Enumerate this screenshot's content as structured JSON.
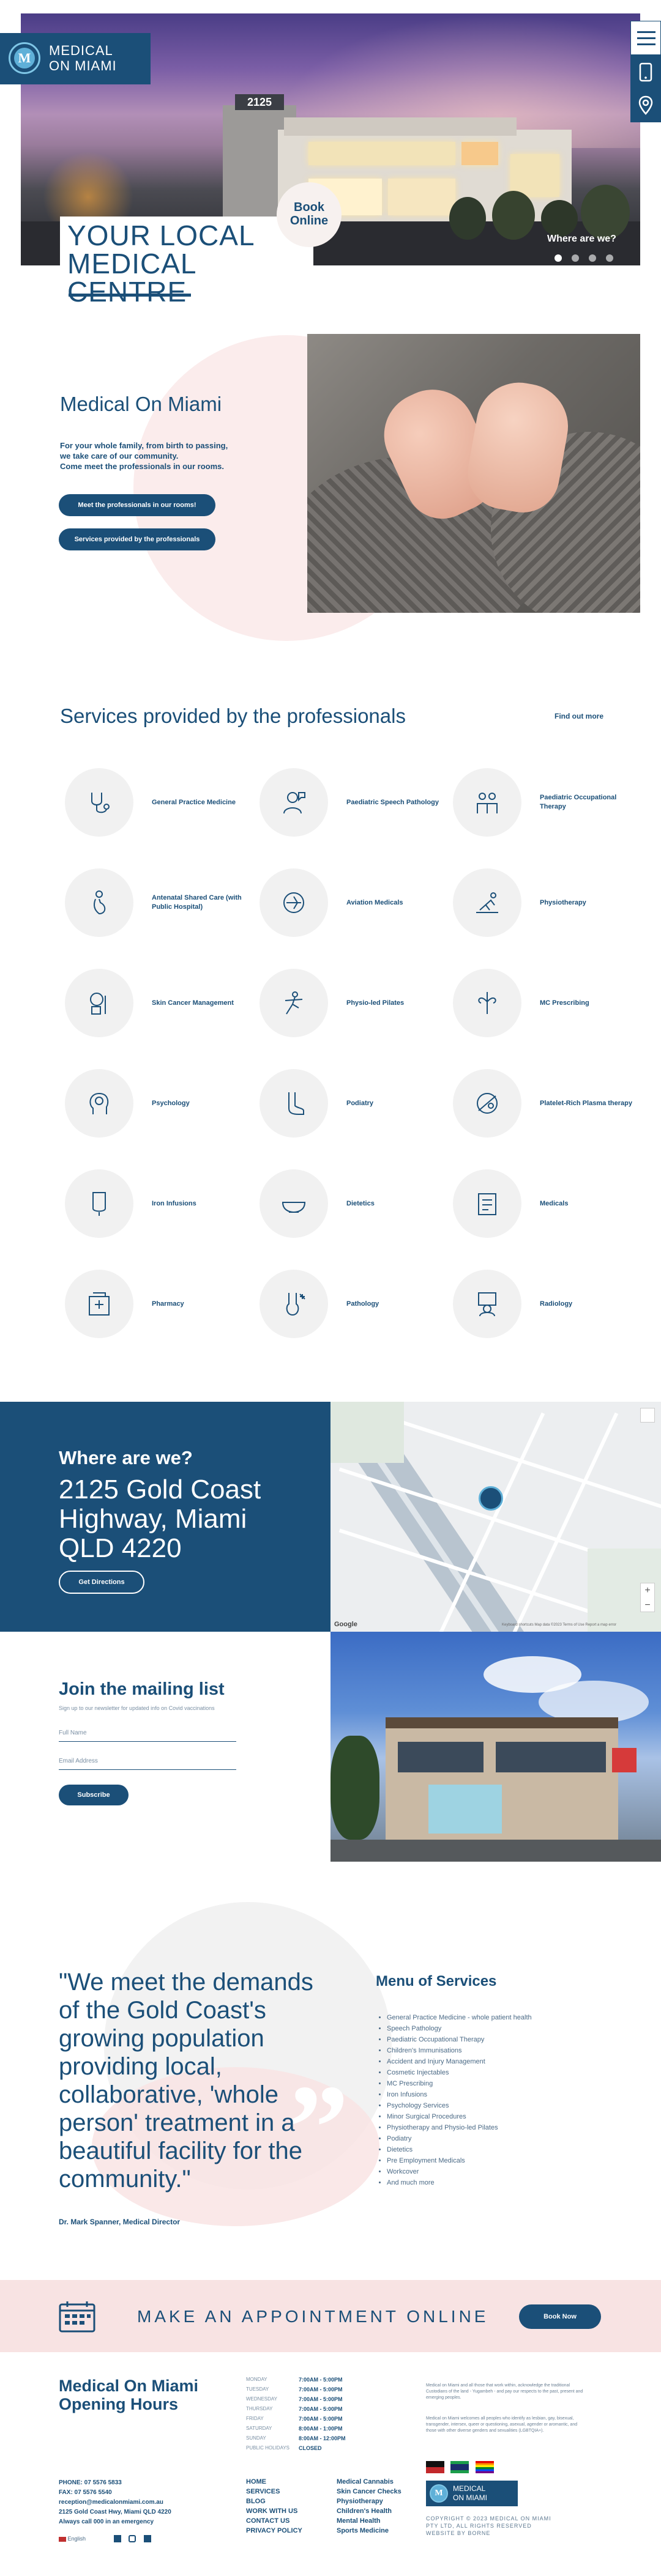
{
  "header": {
    "logo_text": "MEDICAL\nON MIAMI",
    "logo_text_line1": "MEDICAL",
    "logo_text_line2": "ON MIAMI",
    "book_online": "Book\nOnline",
    "book_line1": "Book",
    "book_line2": "Online",
    "hero_title_line1": "YOUR LOCAL",
    "hero_title_line2": "MEDICAL CENTRE",
    "hero_caption": "Where are we?"
  },
  "intro": {
    "title": "Medical On Miami",
    "text_line1": "For your whole family, from birth to passing,",
    "text_line2": "we take care of our community.",
    "text_line3": "Come meet the professionals in our rooms.",
    "btn_professionals": "Meet the professionals in our rooms!",
    "btn_services": "Services provided by the professionals"
  },
  "services": {
    "title": "Services provided by the professionals",
    "find_out_more": "Find out more",
    "items": [
      {
        "label": "General Practice Medicine",
        "icon": "stethoscope-icon"
      },
      {
        "label": "Paediatric Speech Pathology",
        "icon": "speech-icon"
      },
      {
        "label": "Paediatric Occupational Therapy",
        "icon": "family-icon"
      },
      {
        "label": "Antenatal Shared Care (with Public Hospital)",
        "icon": "pregnancy-icon"
      },
      {
        "label": "Aviation Medicals",
        "icon": "aviation-icon"
      },
      {
        "label": "Physiotherapy",
        "icon": "physio-icon"
      },
      {
        "label": "Skin Cancer Management",
        "icon": "skin-icon"
      },
      {
        "label": "Physio-led Pilates",
        "icon": "pilates-icon"
      },
      {
        "label": "MC Prescribing",
        "icon": "leaf-icon"
      },
      {
        "label": "Psychology",
        "icon": "head-icon"
      },
      {
        "label": "Podiatry",
        "icon": "foot-icon"
      },
      {
        "label": "Platelet-Rich Plasma therapy",
        "icon": "plasma-icon"
      },
      {
        "label": "Iron Infusions",
        "icon": "iv-bag-icon"
      },
      {
        "label": "Dietetics",
        "icon": "bowl-icon"
      },
      {
        "label": "Medicals",
        "icon": "clipboard-icon"
      },
      {
        "label": "Pharmacy",
        "icon": "pharmacy-icon"
      },
      {
        "label": "Pathology",
        "icon": "pathology-icon"
      },
      {
        "label": "Radiology",
        "icon": "radiology-icon"
      }
    ]
  },
  "location": {
    "heading": "Where are we?",
    "address_line1": "2125 Gold Coast",
    "address_line2": "Highway, Miami",
    "address_line3": "QLD 4220",
    "btn_directions": "Get Directions",
    "map_footer": "Keyboard shortcuts  Map data ©2023  Terms of Use  Report a map error",
    "map_google": "Google"
  },
  "mailing": {
    "title": "Join the mailing list",
    "subtitle": "Sign up to our newsletter for updated info on Covid vaccinations",
    "full_name_placeholder": "Full Name",
    "email_placeholder": "Email Address",
    "btn_subscribe": "Subscribe"
  },
  "quote": {
    "line1": "\"We meet the demands",
    "line2": "of the Gold Coast's",
    "line3": "growing population",
    "line4": "providing local,",
    "line5": "collaborative, 'whole",
    "line6": "person' treatment in a",
    "line7": "beautiful facility for the",
    "line8": "community.\"",
    "author": "Dr. Mark Spanner, Medical Director"
  },
  "menu_services": {
    "title": "Menu of Services",
    "items": [
      "General Practice Medicine - whole patient health",
      "Speech Pathology",
      "Paediatric Occupational Therapy",
      "Children's Immunisations",
      "Accident and Injury Management",
      "Cosmetic Injectables",
      "MC Prescribing",
      "Iron Infusions",
      "Psychology Services",
      "Minor Surgical Procedures",
      "Physiotherapy and Physio-led Pilates",
      "Podiatry",
      "Dietetics",
      "Pre Employment Medicals",
      "Workcover",
      "And much more"
    ]
  },
  "appointment": {
    "text": "MAKE AN APPOINTMENT ONLINE",
    "btn": "Book Now"
  },
  "hours": {
    "title_line1": "Medical On Miami",
    "title_line2": "Opening Hours",
    "rows": [
      {
        "day": "MONDAY",
        "time": "7:00AM - 5:00PM"
      },
      {
        "day": "TUESDAY",
        "time": "7:00AM - 5:00PM"
      },
      {
        "day": "WEDNESDAY",
        "time": "7:00AM - 5:00PM"
      },
      {
        "day": "THURSDAY",
        "time": "7:00AM - 5:00PM"
      },
      {
        "day": "FRIDAY",
        "time": "7:00AM - 5:00PM"
      },
      {
        "day": "SATURDAY",
        "time": "8:00AM - 1:00PM"
      },
      {
        "day": "SUNDAY",
        "time": "8:00AM - 12:00PM"
      },
      {
        "day": "PUBLIC HOLIDAYS",
        "time": "CLOSED"
      }
    ],
    "ack_text1": "Medical on Miami and all those that work within, acknowledge the traditional Custodians of the land - Yugambeh - and pay our respects to the past, present and emerging peoples.",
    "ack_text2": "Medical on Miami welcomes all peoples who identify as lesbian, gay, bisexual, transgender, intersex, queer or questioning, asexual, agender or aromantic, and those with other diverse genders and sexualities (LGBTQIA+)."
  },
  "footer": {
    "phone": "PHONE: 07 5576 5833",
    "fax": "FAX: 07 5576 5540",
    "email": "reception@medicalonmiami.com.au",
    "address": "2125 Gold Coast Hwy, Miami QLD 4220",
    "emergency": "Always call 000 in an emergency",
    "language": "English",
    "nav1": [
      "HOME",
      "SERVICES",
      "BLOG",
      "WORK WITH US",
      "CONTACT US",
      "PRIVACY POLICY"
    ],
    "nav2": [
      "Medical Cannabis",
      "Skin Cancer Checks",
      "Physiotherapy",
      "Children's Health",
      "Mental Health",
      "Sports Medicine"
    ],
    "logo_line1": "MEDICAL",
    "logo_line2": "ON MIAMI",
    "copyright1": "COPYRIGHT © 2023 MEDICAL ON MIAMI",
    "copyright2": "PTY LTD, ALL RIGHTS RESERVED",
    "credit": "WEBSITE BY BORNE"
  },
  "colors": {
    "navy": "#1b4f78",
    "pink": "#f8e3e3",
    "grey_circle": "#f1f1f1"
  }
}
